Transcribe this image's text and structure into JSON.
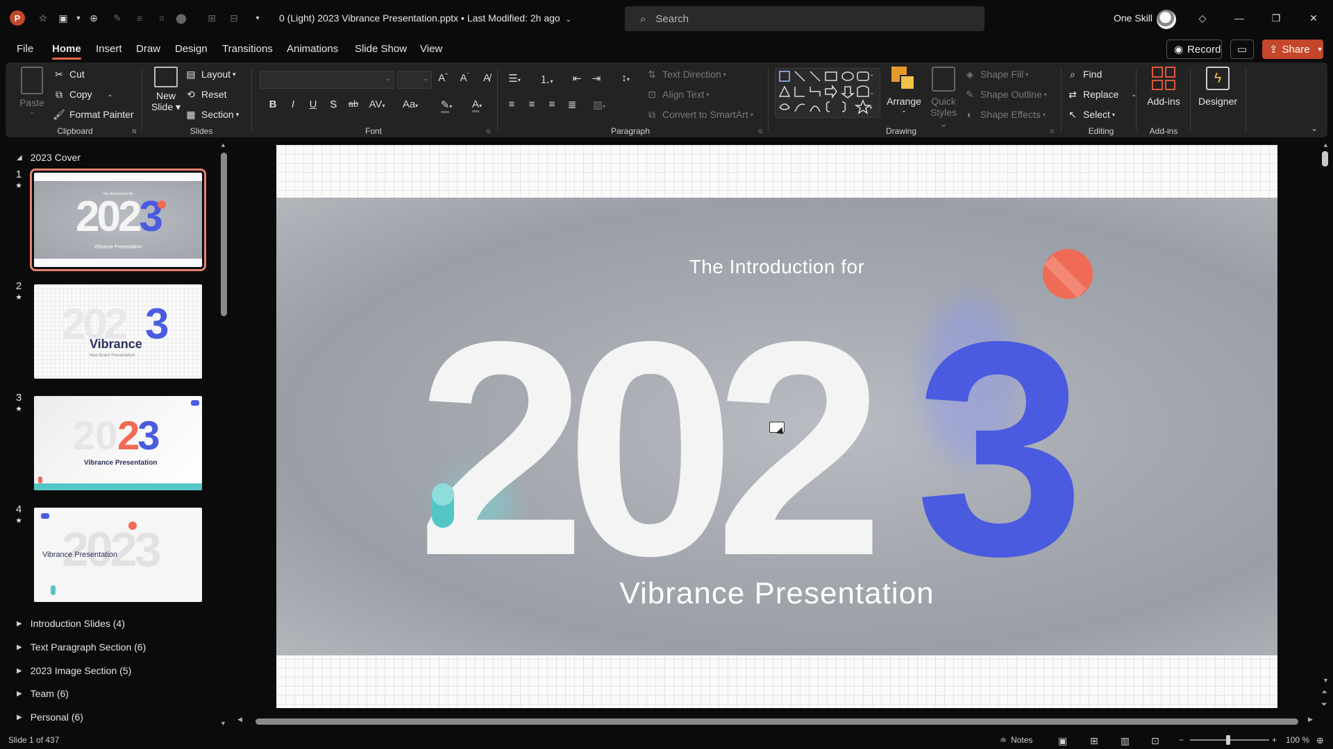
{
  "app": {
    "icon_letter": "P",
    "document_title": "0 (Light) 2023 Vibrance Presentation.pptx • Last Modified: 2h ago",
    "search_placeholder": "Search",
    "user_name": "One Skill"
  },
  "menu": {
    "tabs": [
      "File",
      "Home",
      "Insert",
      "Draw",
      "Design",
      "Transitions",
      "Animations",
      "Slide Show",
      "View"
    ],
    "active_tab": "Home",
    "record_label": "Record",
    "share_label": "Share"
  },
  "ribbon": {
    "clipboard": {
      "paste": "Paste",
      "cut": "Cut",
      "copy": "Copy",
      "format_painter": "Format Painter",
      "label": "Clipboard"
    },
    "slides": {
      "new_slide_line1": "New",
      "new_slide_line2": "Slide",
      "layout": "Layout",
      "reset": "Reset",
      "section": "Section",
      "label": "Slides"
    },
    "font": {
      "label": "Font",
      "bold": "B",
      "italic": "I",
      "underline": "U",
      "shadow": "S",
      "strike": "ab",
      "spacing": "AV",
      "case": "Aa"
    },
    "paragraph": {
      "text_direction": "Text Direction",
      "align_text": "Align Text",
      "convert_smartart": "Convert to SmartArt",
      "label": "Paragraph"
    },
    "drawing": {
      "arrange": "Arrange",
      "quick_styles_line1": "Quick",
      "quick_styles_line2": "Styles",
      "shape_fill": "Shape Fill",
      "shape_outline": "Shape Outline",
      "shape_effects": "Shape Effects",
      "label": "Drawing"
    },
    "editing": {
      "find": "Find",
      "replace": "Replace",
      "select": "Select",
      "label": "Editing"
    },
    "addins": {
      "addins": "Add-ins",
      "label": "Add-ins"
    },
    "designer": {
      "designer": "Designer"
    }
  },
  "thumbnails": {
    "open_section": "2023 Cover",
    "slides": [
      {
        "number": "1",
        "big": "2023",
        "caption_top": "The Introduction for",
        "caption_bottom": "Vibrance Presentation"
      },
      {
        "number": "2",
        "big": "3",
        "caption_top": "Vibrance",
        "caption_bottom": "New Brand Presentation"
      },
      {
        "number": "3",
        "big": "23",
        "caption_top": "Vibrance Presentation",
        "caption_bottom": ""
      },
      {
        "number": "4",
        "big": "2023",
        "caption_top": "Vibrance Presentation",
        "caption_bottom": ""
      }
    ],
    "collapsed_sections": [
      "Introduction Slides (4)",
      "Text Paragraph Section (6)",
      "2023 Image Section (5)",
      "Team (6)",
      "Personal (6)"
    ]
  },
  "slide": {
    "subtitle": "The Introduction for",
    "big_number": "2023",
    "title": "Vibrance Presentation"
  },
  "status": {
    "slide_counter": "Slide 1 of 437",
    "notes": "Notes",
    "zoom": "100 %"
  },
  "colors": {
    "accent_tab": "#e8644a",
    "share": "#c4462b",
    "slide_blue": "#4a5be0",
    "slide_coral": "#ef6b55",
    "slide_teal": "#55c6c7"
  }
}
